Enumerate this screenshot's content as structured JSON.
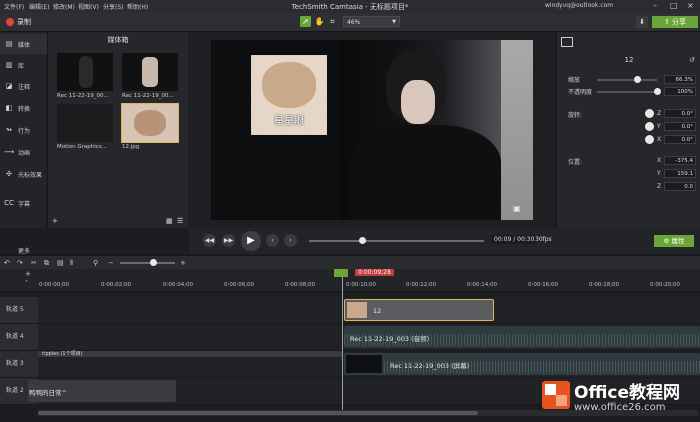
{
  "menubar": {
    "menus": [
      "文件(F)",
      "编辑(E)",
      "修改(M)",
      "视图(V)",
      "分享(S)",
      "帮助(H)"
    ],
    "title": "TechSmith Camtasia - 无标题项目*",
    "account": "windyvq@outlook.com",
    "window_controls": [
      "minimize-icon",
      "maximize-icon",
      "close-icon"
    ]
  },
  "toolbar": {
    "record_label": "录制",
    "zoom_value": "46%",
    "share_label": "分享"
  },
  "sidebar": {
    "items": [
      {
        "icon": "media-icon",
        "label": "媒体"
      },
      {
        "icon": "library-icon",
        "label": "库"
      },
      {
        "icon": "annotation-icon",
        "label": "注释"
      },
      {
        "icon": "transition-icon",
        "label": "转换"
      },
      {
        "icon": "behavior-icon",
        "label": "行为"
      },
      {
        "icon": "animation-icon",
        "label": "动画"
      },
      {
        "icon": "cursor-effect-icon",
        "label": "光标效果"
      },
      {
        "icon": "caption-icon",
        "label": "字幕"
      }
    ],
    "more_label": "更多"
  },
  "bin": {
    "title": "媒体箱",
    "items": [
      {
        "label": "Rec 11-22-19_00..."
      },
      {
        "label": "Rec 11-22-19_00..."
      },
      {
        "label": "Motion Graphics..."
      },
      {
        "label": "12.jpg"
      }
    ]
  },
  "canvas": {
    "caption": "星星眼"
  },
  "properties": {
    "title": "12",
    "scale_label": "缩放",
    "scale_value": "66.3%",
    "scale_fraction": 0.663,
    "opacity_label": "不透明度",
    "opacity_value": "100%",
    "opacity_fraction": 1.0,
    "rotation_label": "旋转:",
    "rotation": [
      {
        "axis": "Z",
        "value": "0.0°"
      },
      {
        "axis": "Y",
        "value": "0.0°"
      },
      {
        "axis": "X",
        "value": "0.0°"
      }
    ],
    "position_label": "位置:",
    "position": [
      {
        "axis": "X",
        "value": "-375.4"
      },
      {
        "axis": "Y",
        "value": "159.1"
      },
      {
        "axis": "Z",
        "value": "0.0"
      }
    ],
    "attr_button": "属性"
  },
  "playback": {
    "timecode": "00:09 / 00:30",
    "fps": "30fps",
    "progress_fraction": 0.3
  },
  "timeline": {
    "playhead": "0:00:09;28",
    "ruler_ticks": [
      "0:00:00;00",
      "0:00:02;00",
      "0:00:04;00",
      "0:00:06;00",
      "0:00:08;00",
      "0:00:10;00",
      "0:00:12;00",
      "0:00:14;00",
      "0:00:16;00",
      "0:00:18;00",
      "0:00:20;00"
    ],
    "tracks": [
      {
        "name": "轨道 5"
      },
      {
        "name": "轨道 4"
      },
      {
        "name": "轨道 3"
      },
      {
        "name": "轨道 2"
      }
    ],
    "clips": {
      "image_clip": "12",
      "audio_clip": "Rec 11-22-19_003 (音频)",
      "screen_clip": "Rec 11-22-19_003 (屏幕)",
      "ripples_group": "ripples  (1个项目)",
      "track2_clip": "鸭鸭的日常^"
    }
  },
  "watermark": {
    "name": "Office教程网",
    "url": "www.office26.com"
  }
}
